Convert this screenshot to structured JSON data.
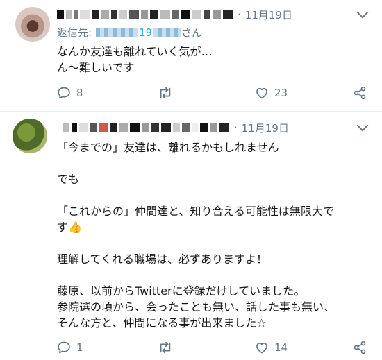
{
  "tweets": [
    {
      "date": "11月19日",
      "reply_prefix": "返信先:",
      "reply_handle_visible": "19",
      "reply_suffix": "さん",
      "text": [
        "なんか友達も離れていく気が…",
        "ん〜難しいです"
      ],
      "replies": "8",
      "retweets": "",
      "likes": "23"
    },
    {
      "date": "11月19日",
      "text": [
        "「今までの」友達は、離れるかもしれません",
        "",
        "でも",
        "",
        "「これからの」仲間達と、知り合える可能性は無限大で",
        "す👍",
        "",
        "理解してくれる職場は、必ずありますよ！",
        "",
        "藤原、以前からTwitterに登録だけしていました。",
        "参院選の頃から、会ったことも無い、話した事も無い、",
        "そんな方と、仲間になる事が出来ました☆"
      ],
      "replies": "1",
      "retweets": "",
      "likes": "14"
    }
  ],
  "icons": [
    "reply-icon",
    "retweet-icon",
    "like-icon",
    "share-icon",
    "chevron-down-icon"
  ],
  "colors": {
    "secondary": "#657786",
    "link": "#1da1f2",
    "text": "#14171a",
    "divider": "#e6ecf0"
  }
}
